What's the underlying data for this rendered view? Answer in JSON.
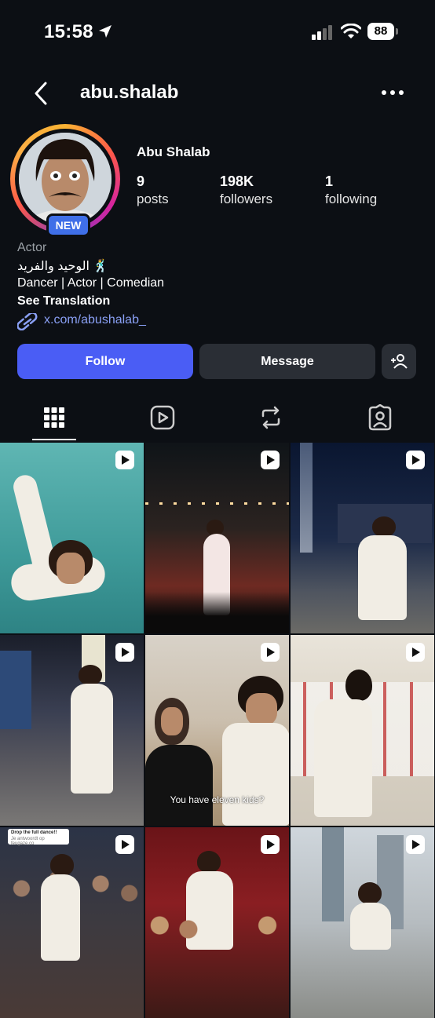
{
  "status_bar": {
    "time": "15:58",
    "battery": "88"
  },
  "header": {
    "username": "abu.shalab"
  },
  "profile": {
    "display_name": "Abu Shalab",
    "badge": "NEW",
    "stats": {
      "posts_count": "9",
      "posts_label": "posts",
      "followers_count": "198K",
      "followers_label": "followers",
      "following_count": "1",
      "following_label": "following"
    },
    "bio": {
      "category": "Actor",
      "arabic_line": "الوحيد والفريد 🕺",
      "roles": "Dancer | Actor | Comedian",
      "see_translation": "See Translation",
      "link": "x.com/abushalab_"
    }
  },
  "actions": {
    "follow": "Follow",
    "message": "Message"
  },
  "tabs": [
    "grid-icon",
    "reels-icon",
    "reposts-icon",
    "tagged-icon"
  ],
  "grid": {
    "tiles": [
      {
        "scene": "underwater pool"
      },
      {
        "scene": "night party"
      },
      {
        "scene": "city night"
      },
      {
        "scene": "times square"
      },
      {
        "scene": "desert",
        "caption": "You have eleven kids?"
      },
      {
        "scene": "wedding hall"
      },
      {
        "scene": "crowd",
        "sticker_title": "Drop the full dance!!",
        "sticker_sub": "Je antwoordt op feugaze.co"
      },
      {
        "scene": "red stage"
      },
      {
        "scene": "marina"
      }
    ]
  },
  "colors": {
    "follow_button": "#4a5df5",
    "background": "#0c0f14",
    "link": "#8aa0f5"
  }
}
